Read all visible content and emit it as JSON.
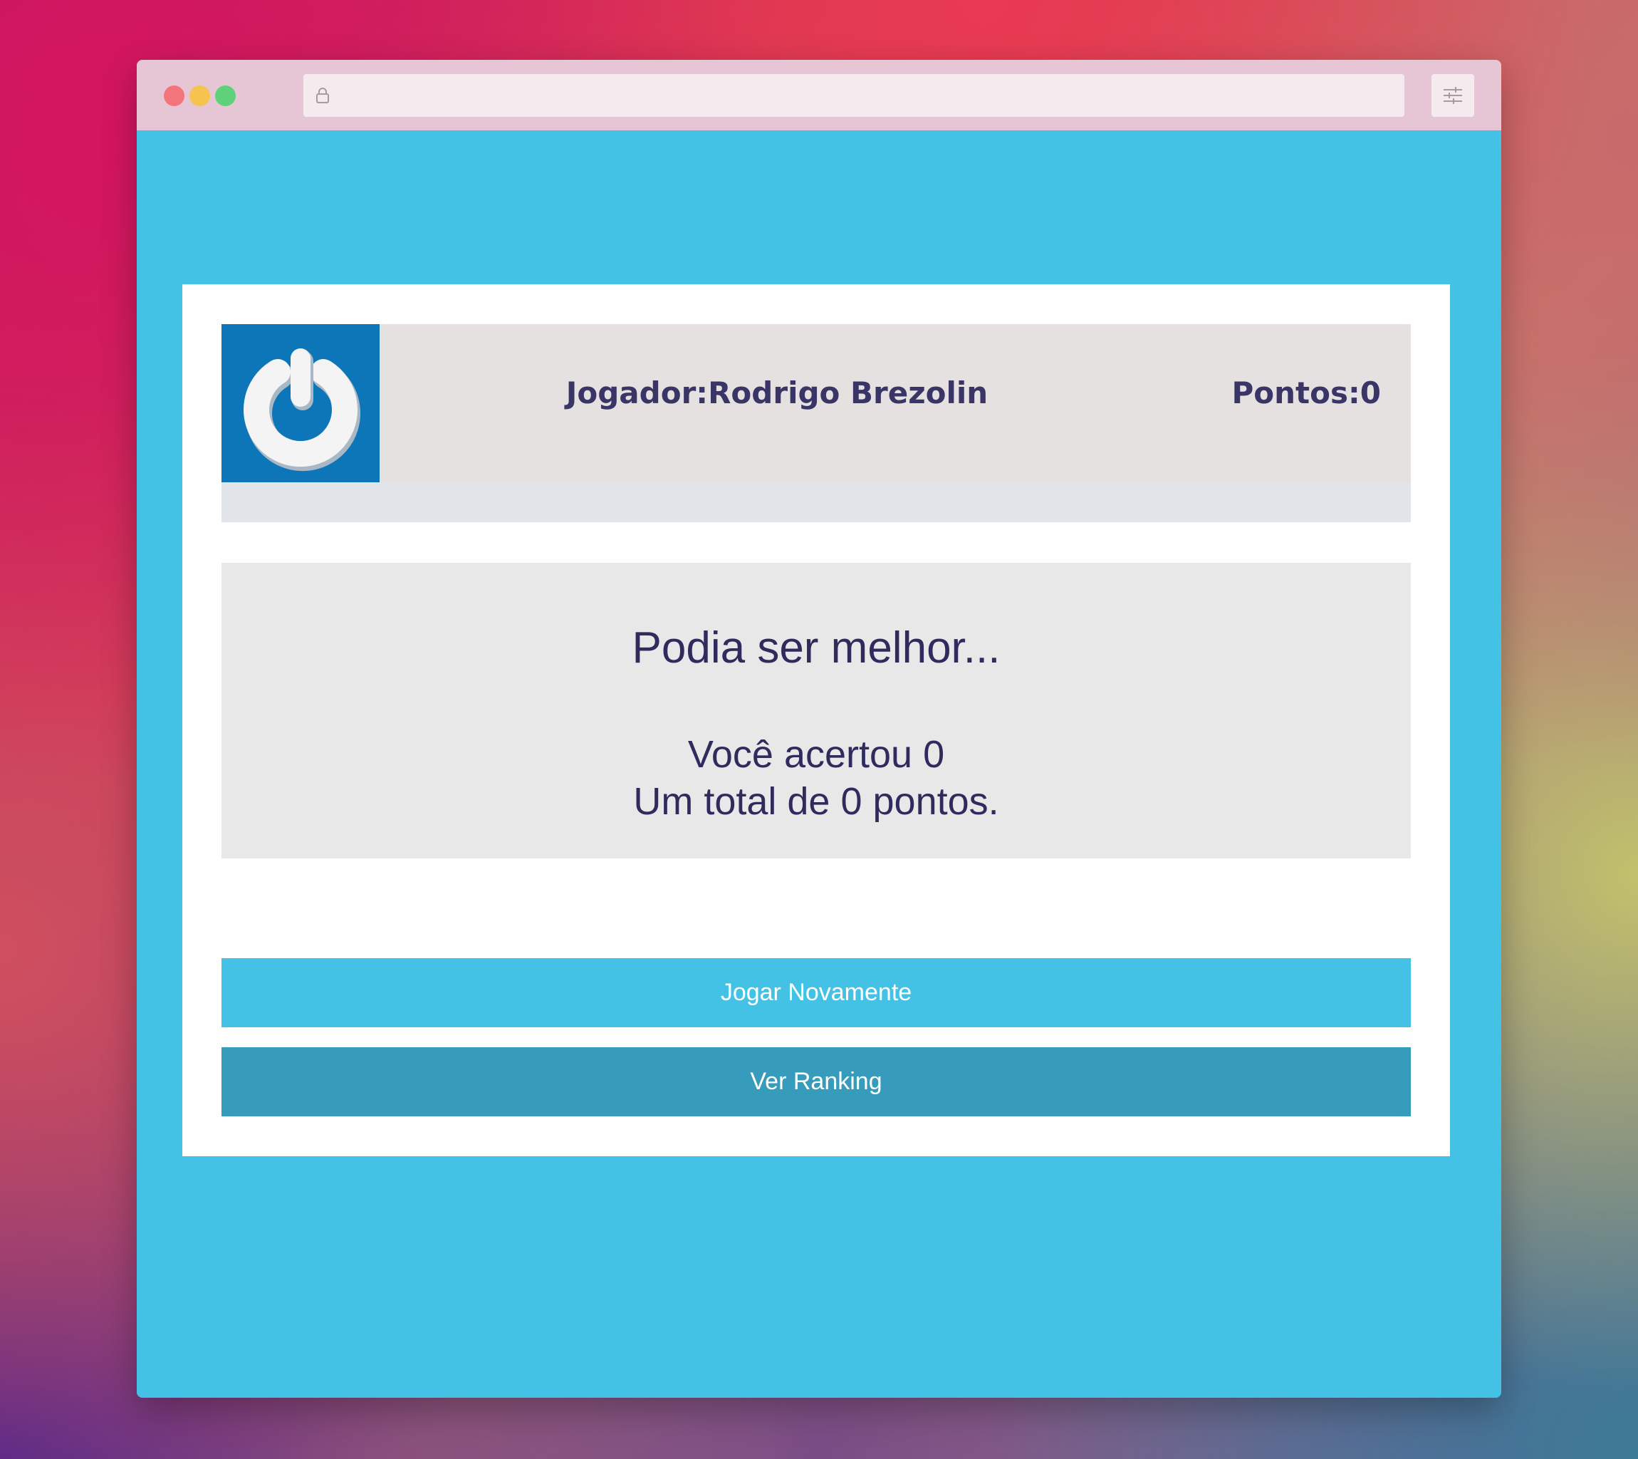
{
  "header": {
    "player_label": "Jogador:",
    "player_name": "Rodrigo Brezolin",
    "points_label": "Pontos:",
    "points_value": "0"
  },
  "result": {
    "title": "Podia ser melhor...",
    "line1": "Você acertou 0",
    "line2": "Um total de 0 pontos."
  },
  "actions": {
    "play_again_label": "Jogar Novamente",
    "ranking_label": "Ver Ranking"
  },
  "colors": {
    "page_background": "#44c2e5",
    "logo_background": "#0d76b9",
    "play_again_button": "#44c2e5",
    "ranking_button": "#379bbb",
    "text": "#2f2b5c"
  },
  "icons": {
    "logo": "power-icon",
    "address_bar": "lock-icon",
    "toolbar": "sliders-icon"
  }
}
